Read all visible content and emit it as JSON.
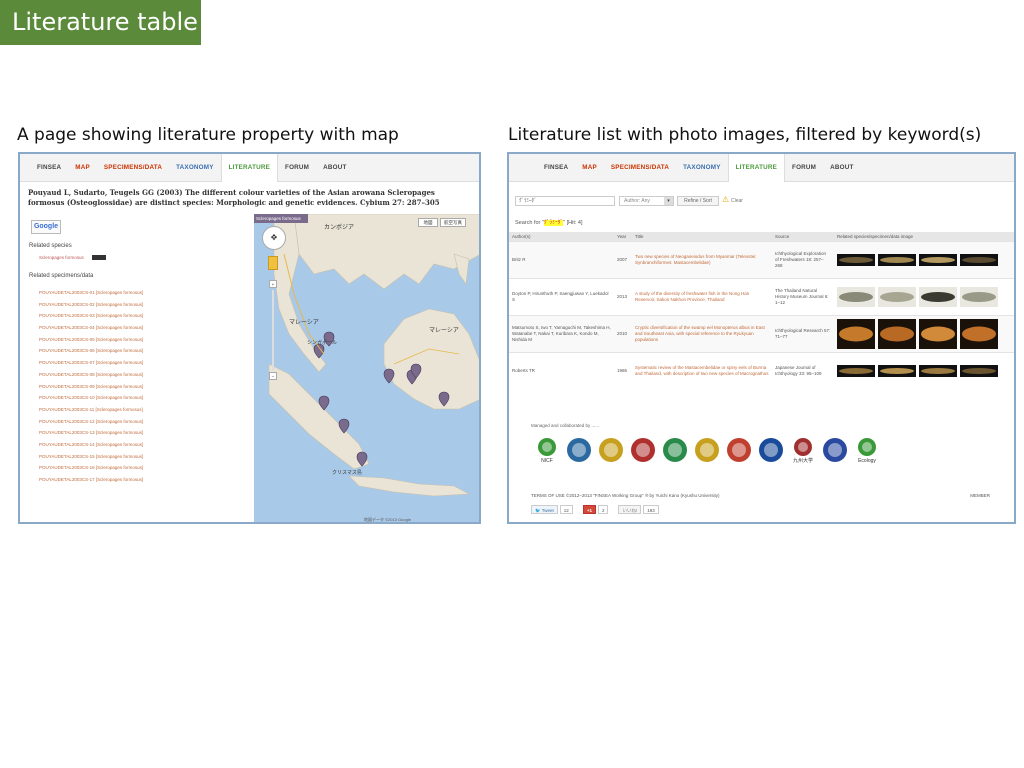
{
  "slide": {
    "title": "Literature table",
    "caption_left": "A page showing literature property with map",
    "caption_right": "Literature list with photo images, filtered by keyword(s)"
  },
  "nav": {
    "items": [
      "FINSEA",
      "MAP",
      "SPECIMENS/DATA",
      "TAXONOMY",
      "LITERATURE",
      "FORUM",
      "ABOUT"
    ],
    "colors": [
      "#444444",
      "#cc3300",
      "#cc3300",
      "#3a6fb0",
      "#4a9a3a",
      "#444444",
      "#444444"
    ],
    "active_index": 4
  },
  "left_page": {
    "paper_title": "Pouyaud L, Sudarto, Teugels GG (2003) The different colour varieties of the Asian arowana Scleropages formosus (Osteoglossidae) are distinct species: Morphologic and genetic evidences. Cybium 27: 287–305",
    "google_label": "Google",
    "related_species_heading": "Related species",
    "related_species": "Scleropages formosus",
    "related_specimens_heading": "Related specimens/data",
    "specimens": [
      "POUYAUDETAL2003CS-01 [Scleropages formosus]",
      "POUYAUDETAL2003CS-02 [Scleropages formosus]",
      "POUYAUDETAL2003CS-03 [Scleropages formosus]",
      "POUYAUDETAL2003CS-04 [Scleropages formosus]",
      "POUYAUDETAL2003CS-05 [Scleropages formosus]",
      "POUYAUDETAL2003CS-06 [Scleropages formosus]",
      "POUYAUDETAL2003CS-07 [Scleropages formosus]",
      "POUYAUDETAL2003CS-08 [Scleropages formosus]",
      "POUYAUDETAL2003CS-09 [Scleropages formosus]",
      "POUYAUDETAL2003CS-10 [Scleropages formosus]",
      "POUYAUDETAL2003CS-11 [Scleropages formosus]",
      "POUYAUDETAL2003CS-12 [Scleropages formosus]",
      "POUYAUDETAL2003CS-13 [Scleropages formosus]",
      "POUYAUDETAL2003CS-14 [Scleropages formosus]",
      "POUYAUDETAL2003CS-15 [Scleropages formosus]",
      "POUYAUDETAL2003CS-16 [Scleropages formosus]",
      "POUYAUDETAL2003CS-17 [Scleropages formosus]"
    ],
    "map": {
      "tag": "Scleropages formosus",
      "type_buttons": [
        "地図",
        "航空写真"
      ],
      "labels": {
        "cambodia": "カンボジア",
        "malaysia": "マレーシア",
        "singapore": "シンガポール",
        "malaysia_east": "マレーシア",
        "christmas": "クリスマス島"
      },
      "legal": "地図データ ©2013 Google"
    }
  },
  "right_page": {
    "search_value": "ｸﾞﾗﾐｰﾀﾞ",
    "author_select": "Author: Any",
    "refine_label": "Refine / Sort",
    "clear_label": "Clear",
    "search_prefix": "Search for \"",
    "search_keyword": "ｸﾞﾗﾐｰﾀﾞ",
    "search_suffix": "\" [Hit: 4]",
    "headers": [
      "Author(s)",
      "Year",
      "Title",
      "Source",
      "Related species/specimen/data image"
    ],
    "rows": [
      {
        "author": "Britz R",
        "year": "2007",
        "title": "Two new species of Neoganeiodus from Myanmar (Teleostei: Synbranchiformes: Mastacembelidae)",
        "source": "Ichthyological Exploration of Freshwaters 18: 257–268",
        "fish_colors": [
          "#6b5a35",
          "#a08850",
          "#b49a60",
          "#5a4a30"
        ]
      },
      {
        "author": "Doyton P, Hirunthuth P, Saengjuwan Y, Luekadol S",
        "year": "2013",
        "title": "A study of the diversity of freshwater fish in the Nong Han Reservoir, Sakon Nakhon Province, Thailand",
        "source": "The Thailand Natural History Museum Journal 6: 1–12",
        "fish_colors": [
          "#8a8a78",
          "#a6a692",
          "#3a3a30",
          "#9a9a88"
        ]
      },
      {
        "author": "Matsumoto S, Iwo T, Yamaguchi M, Takeshima H, Watanabe T, Nakai T, Kuribara K, Kondo M, Nishida M",
        "year": "2010",
        "title": "Cryptic diversification of the swamp eel Monopterus albus in East and Southeast Asia, with special reference to the Ryukyuan populations",
        "source": "Ichthyological Research 57: 71–77",
        "fish_colors": [
          "#c47a2a",
          "#b86a24",
          "#d08a3a",
          "#c07028"
        ]
      },
      {
        "author": "Roberts TR",
        "year": "1986",
        "title": "Systematic review of the Mastacembelidae or spiny eels of Burma and Thailand, with description of two new species of Macrognathus",
        "source": "Japanese Journal of Ichthyology 33: 95–109",
        "fish_colors": [
          "#8a6a35",
          "#b4904e",
          "#9a7a40",
          "#6a5430"
        ]
      }
    ],
    "managed_label": "Managed and collaborated by ......",
    "logos": [
      {
        "name": "nicf-logo",
        "color": "#3a9a3a",
        "text": "NICF"
      },
      {
        "name": "diamond-logo",
        "color": "#2a6aa0",
        "text": ""
      },
      {
        "name": "gold-seal-logo",
        "color": "#c8a020",
        "text": ""
      },
      {
        "name": "red-seal-logo",
        "color": "#b03030",
        "text": ""
      },
      {
        "name": "green-seal-logo",
        "color": "#2a8a4a",
        "text": ""
      },
      {
        "name": "pagoda-logo",
        "color": "#c8a020",
        "text": ""
      },
      {
        "name": "circle-emblem-logo",
        "color": "#c04030",
        "text": ""
      },
      {
        "name": "blue-crest-logo",
        "color": "#1a4a9a",
        "text": ""
      },
      {
        "name": "kyushu-logo",
        "color": "#a03030",
        "text": "九州大学"
      },
      {
        "name": "shield-logo",
        "color": "#2a4aa0",
        "text": ""
      },
      {
        "name": "ecology-logo",
        "color": "#3a9a3a",
        "text": "Ecology"
      }
    ],
    "terms": "TERMS OF USE ©2012–2013 \"FINSEA Working Group\" ℗ by Yuichi Kano (Kyushu University)",
    "member": "MEMBER",
    "social": {
      "tweet": "Tweet",
      "tweet_count": "12",
      "gplus": "+1",
      "gplus_count": "2",
      "like": "いいね!",
      "like_count": "193"
    }
  }
}
